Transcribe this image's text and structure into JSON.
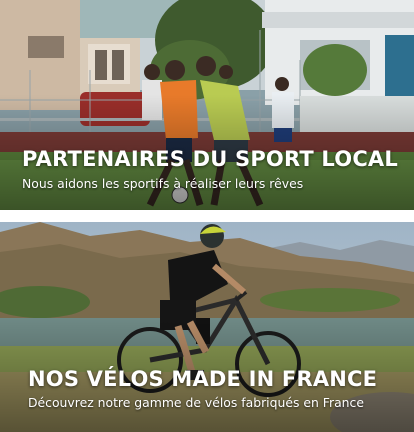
{
  "banners": [
    {
      "title": "PARTENAIRES DU SPORT LOCAL",
      "subtitle": "Nous aidons les sportifs à réaliser leurs rêves"
    },
    {
      "title": "NOS VÉLOS MADE IN FRANCE",
      "subtitle": "Découvrez notre gamme de vélos fabriqués en France"
    }
  ]
}
